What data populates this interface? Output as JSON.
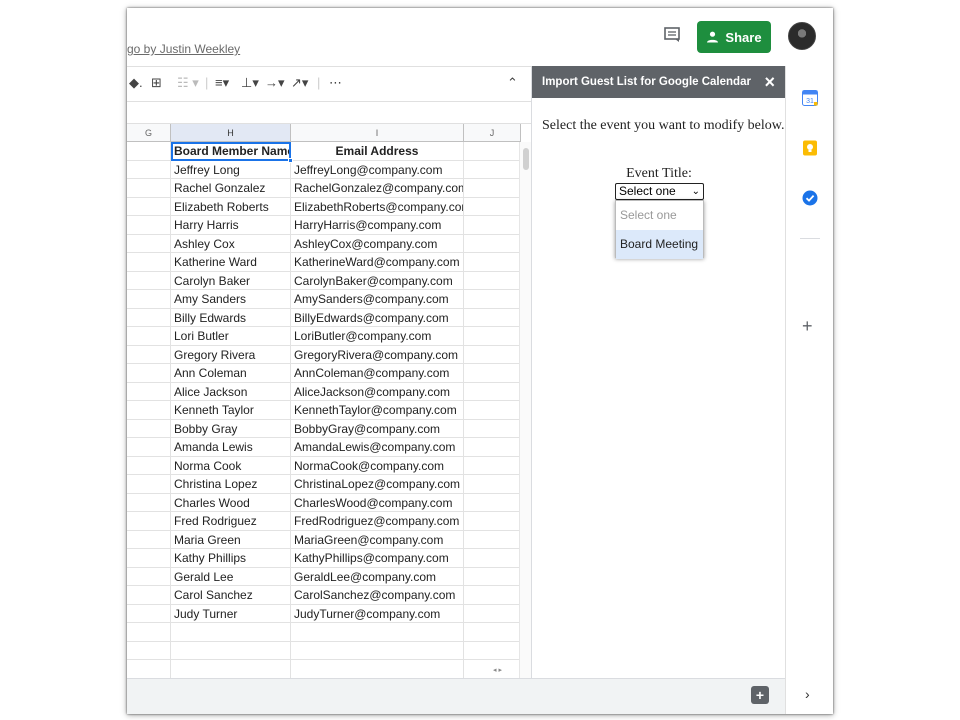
{
  "header": {
    "byline": "go by Justin Weekley",
    "share_label": "Share"
  },
  "toolbar": {
    "more_label": "⋯"
  },
  "sheet": {
    "columns": [
      {
        "letter": "G"
      },
      {
        "letter": "H"
      },
      {
        "letter": "I"
      },
      {
        "letter": "J"
      }
    ],
    "header_row": [
      "Board Member Name",
      "Email Address"
    ],
    "rows": [
      [
        "Jeffrey Long",
        "JeffreyLong@company.com"
      ],
      [
        "Rachel Gonzalez",
        "RachelGonzalez@company.com"
      ],
      [
        "Elizabeth Roberts",
        "ElizabethRoberts@company.com"
      ],
      [
        "Harry Harris",
        "HarryHarris@company.com"
      ],
      [
        "Ashley Cox",
        "AshleyCox@company.com"
      ],
      [
        "Katherine Ward",
        "KatherineWard@company.com"
      ],
      [
        "Carolyn Baker",
        "CarolynBaker@company.com"
      ],
      [
        "Amy Sanders",
        "AmySanders@company.com"
      ],
      [
        "Billy Edwards",
        "BillyEdwards@company.com"
      ],
      [
        "Lori Butler",
        "LoriButler@company.com"
      ],
      [
        "Gregory Rivera",
        "GregoryRivera@company.com"
      ],
      [
        "Ann Coleman",
        "AnnColeman@company.com"
      ],
      [
        "Alice Jackson",
        "AliceJackson@company.com"
      ],
      [
        "Kenneth Taylor",
        "KennethTaylor@company.com"
      ],
      [
        "Bobby Gray",
        "BobbyGray@company.com"
      ],
      [
        "Amanda Lewis",
        "AmandaLewis@company.com"
      ],
      [
        "Norma Cook",
        "NormaCook@company.com"
      ],
      [
        "Christina Lopez",
        "ChristinaLopez@company.com"
      ],
      [
        "Charles Wood",
        "CharlesWood@company.com"
      ],
      [
        "Fred Rodriguez",
        "FredRodriguez@company.com"
      ],
      [
        "Maria Green",
        "MariaGreen@company.com"
      ],
      [
        "Kathy Phillips",
        "KathyPhillips@company.com"
      ],
      [
        "Gerald Lee",
        "GeraldLee@company.com"
      ],
      [
        "Carol Sanchez",
        "CarolSanchez@company.com"
      ],
      [
        "Judy Turner",
        "JudyTurner@company.com"
      ]
    ]
  },
  "panel": {
    "title": "Import Guest List for Google Calendar",
    "close": "×",
    "instructions": "Select the event you want to modify below.",
    "event_label": "Event Title:",
    "select_value": "Select one",
    "options": [
      "Select one",
      "Board Meeting"
    ]
  },
  "colors": {
    "share_green": "#1e8e3e",
    "panel_header": "#5f6368",
    "selection_blue": "#1a73e8"
  }
}
